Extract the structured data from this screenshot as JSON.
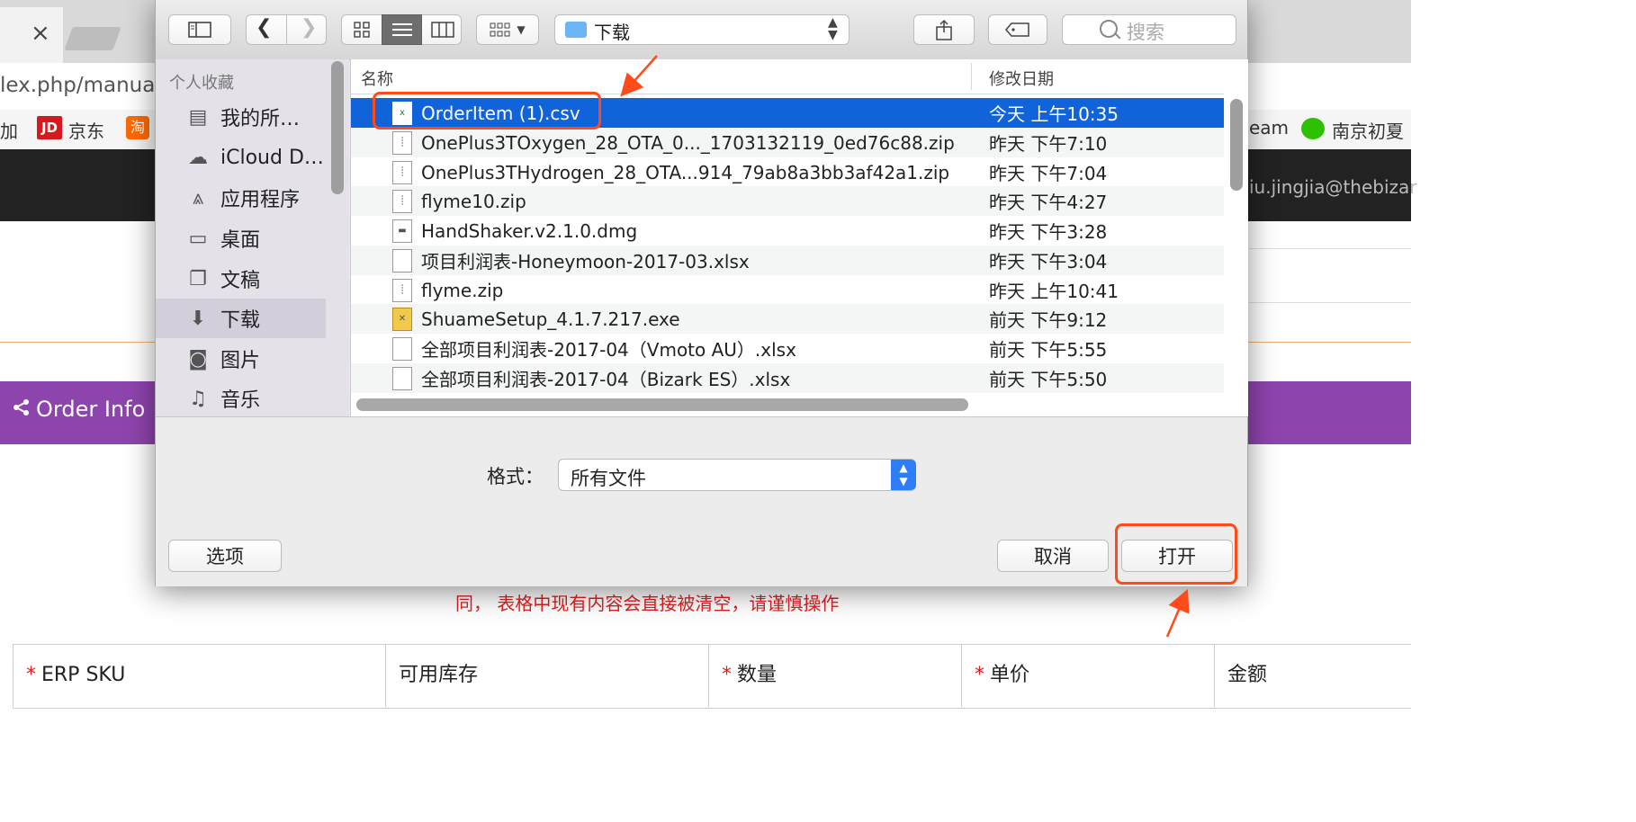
{
  "browser": {
    "url_fragment": "lex.php/manualo",
    "bookmarks": [
      "加",
      "京东",
      "eam",
      "南京初夏"
    ],
    "jd_icon": "JD",
    "taobao_icon": "淘",
    "account_email": "iu.jingjia@thebizar"
  },
  "page": {
    "section_title": "Order Info",
    "warning_note": "同， 表格中现有内容会直接被清空，请谨慎操作",
    "table_headers": [
      {
        "label": "ERP SKU",
        "required": true
      },
      {
        "label": "可用库存",
        "required": false
      },
      {
        "label": "数量",
        "required": true
      },
      {
        "label": "单价",
        "required": true
      },
      {
        "label": "金额",
        "required": false
      }
    ],
    "required_mark": "*"
  },
  "dialog": {
    "location": "下载",
    "search_placeholder": "搜索",
    "sidebar": {
      "header": "个人收藏",
      "items": [
        {
          "label": "我的所…",
          "icon": "all-files-icon"
        },
        {
          "label": "iCloud D…",
          "icon": "cloud-icon"
        },
        {
          "label": "应用程序",
          "icon": "applications-icon"
        },
        {
          "label": "桌面",
          "icon": "desktop-icon"
        },
        {
          "label": "文稿",
          "icon": "documents-icon"
        },
        {
          "label": "下载",
          "icon": "downloads-icon",
          "selected": true
        },
        {
          "label": "图片",
          "icon": "camera-icon"
        },
        {
          "label": "音乐",
          "icon": "music-icon"
        }
      ]
    },
    "columns": {
      "name": "名称",
      "date": "修改日期"
    },
    "files": [
      {
        "name": "OrderItem (1).csv",
        "date": "今天 上午10:35",
        "selected": true,
        "kind": "csv"
      },
      {
        "name": "OnePlus3TOxygen_28_OTA_0..._1703132119_0ed76c88.zip",
        "date": "昨天 下午7:10",
        "kind": "zip"
      },
      {
        "name": "OnePlus3THydrogen_28_OTA...914_79ab8a3bb3af42a1.zip",
        "date": "昨天 下午7:04",
        "kind": "zip"
      },
      {
        "name": "flyme10.zip",
        "date": "昨天 下午4:27",
        "kind": "zip"
      },
      {
        "name": "HandShaker.v2.1.0.dmg",
        "date": "昨天 下午3:28",
        "kind": "dmg"
      },
      {
        "name": "项目利润表-Honeymoon-2017-03.xlsx",
        "date": "昨天 下午3:04",
        "kind": "doc"
      },
      {
        "name": "flyme.zip",
        "date": "昨天 上午10:41",
        "kind": "zip"
      },
      {
        "name": "ShuameSetup_4.1.7.217.exe",
        "date": "前天 下午9:12",
        "kind": "exe"
      },
      {
        "name": "全部项目利润表-2017-04（Vmoto AU）.xlsx",
        "date": "前天 下午5:55",
        "kind": "doc"
      },
      {
        "name": "全部项目利润表-2017-04（Bizark ES）.xlsx",
        "date": "前天 下午5:50",
        "kind": "doc"
      }
    ],
    "format_label": "格式：",
    "format_value": "所有文件",
    "options_button": "选项",
    "cancel_button": "取消",
    "open_button": "打开"
  },
  "colors": {
    "selection": "#1163d9",
    "purple_bar": "#8e44ad",
    "annotation": "#ff4a1a",
    "warning": "#e02020"
  }
}
